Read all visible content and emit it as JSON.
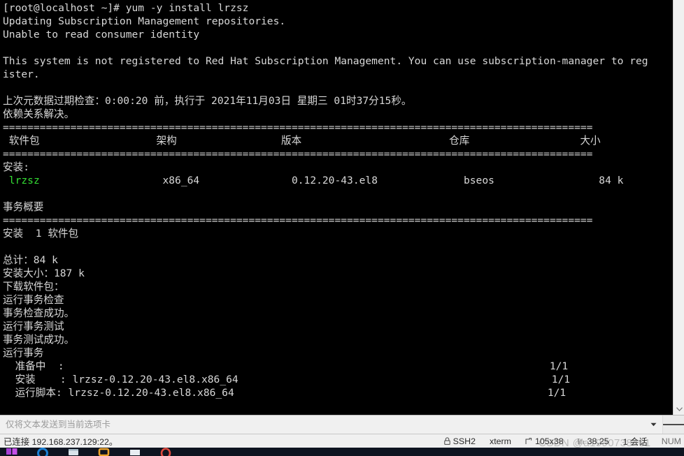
{
  "terminal": {
    "lines": [
      {
        "text": "[root@localhost ~]# yum -y install lrzsz"
      },
      {
        "text": "Updating Subscription Management repositories."
      },
      {
        "text": "Unable to read consumer identity"
      },
      {
        "text": ""
      },
      {
        "text": "This system is not registered to Red Hat Subscription Management. You can use subscription-manager to reg"
      },
      {
        "text": "ister."
      },
      {
        "text": ""
      },
      {
        "text": "上次元数据过期检查：0:00:20 前，执行于 2021年11月03日 星期三 01时37分15秒。"
      },
      {
        "text": "依赖关系解决。"
      },
      {
        "text": "================================================================================================",
        "kind": "rule"
      },
      {
        "text": " 软件包                   架构                 版本                        仓库                  大小"
      },
      {
        "text": "================================================================================================",
        "kind": "rule"
      },
      {
        "text": "安装:"
      },
      {
        "text": " lrzsz                    x86_64               0.12.20-43.el8              bseos                 84 k",
        "kind": "package"
      },
      {
        "text": ""
      },
      {
        "text": "事务概要"
      },
      {
        "text": "================================================================================================",
        "kind": "rule"
      },
      {
        "text": "安装  1 软件包"
      },
      {
        "text": ""
      },
      {
        "text": "总计：84 k"
      },
      {
        "text": "安装大小：187 k"
      },
      {
        "text": "下载软件包："
      },
      {
        "text": "运行事务检查"
      },
      {
        "text": "事务检查成功。"
      },
      {
        "text": "运行事务测试"
      },
      {
        "text": "事务测试成功。"
      },
      {
        "text": "运行事务"
      },
      {
        "text": "  准备中  :                                                                               1/1"
      },
      {
        "text": "  安装    : lrzsz-0.12.20-43.el8.x86_64                                                   1/1"
      },
      {
        "text": "  运行脚本: lrzsz-0.12.20-43.el8.x86_64                                                   1/1"
      }
    ],
    "package_row": {
      "name": "lrzsz",
      "arch": "x86_64",
      "version": "0.12.20-43.el8",
      "repo": "bseos",
      "size": "84 k"
    },
    "table_headers": {
      "package": "软件包",
      "arch": "架构",
      "version": "版本",
      "repo": "仓库",
      "size": "大小"
    },
    "colors": {
      "background": "#000000",
      "foreground": "#d8d8d8",
      "package_green": "#35e035"
    }
  },
  "sendbar": {
    "placeholder": "仅将文本发送到当前选项卡",
    "value": "",
    "dropdown_icon": "chevron-down-icon",
    "menu_icon": "hamburger-menu-icon"
  },
  "statusbar": {
    "connection": "已连接 192.168.237.129:22。",
    "protocol": "SSH2",
    "terminal_type": "xterm",
    "size": "105x38",
    "cursor": "38,25",
    "sessions": "1 会话",
    "num_lock": "NUM",
    "lock_icon": "lock-icon",
    "resize_icon": "resize-icon",
    "cursor_icon": "cursor-position-icon"
  },
  "watermark": {
    "text": "CSDN @a1990738401"
  }
}
